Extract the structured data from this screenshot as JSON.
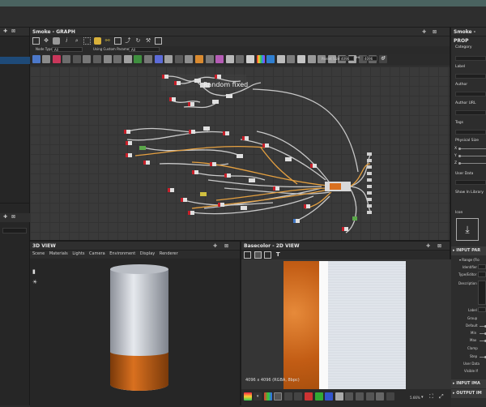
{
  "graph": {
    "title": "Smoke - GRAPH",
    "node_type_label": "Node Type",
    "node_type_value": "All",
    "custom_param_label": "Using Custom Parameter",
    "custom_param_value": "All",
    "parent_size_label": "Parent Size",
    "parent_size_w": "4096",
    "parent_size_h": "4096",
    "frame_text": "Random fixed"
  },
  "view3d": {
    "title": "3D VIEW",
    "menu": [
      "Scene",
      "Materials",
      "Lights",
      "Camera",
      "Environment",
      "Display",
      "Renderer"
    ]
  },
  "view2d": {
    "title": "Basecolor - 2D VIEW",
    "status": "4096 x 4096 (RGBA, 8bpc)",
    "zoom": "5.66%"
  },
  "properties": {
    "title": "Smoke - PROP",
    "fields": [
      "Category",
      "Label",
      "Author",
      "Author URL",
      "Tags"
    ],
    "physical_size_label": "Physical Size",
    "axes": [
      "X",
      "Y",
      "Z"
    ],
    "user_data_label": "User Data",
    "show_in_library_label": "Show In Library",
    "icon_label": "Icon",
    "input_params_header": "INPUT PAR",
    "range_label": "Range (Flo",
    "param_rows": [
      "Identifier",
      "Type/Editor",
      "Description"
    ],
    "lower_rows": [
      "Label",
      "Group",
      "Default",
      "Min",
      "Max",
      "Clamp",
      "Step",
      "User Data",
      "Visible If"
    ],
    "input_images_header": "INPUT IMA",
    "output_images_header": "OUTPUT IM"
  },
  "colors": {
    "accent_orange": "#d9701f",
    "node_red": "#c8202a",
    "wire_orange": "#e5a040",
    "graph_bg": "#3b3b3b",
    "topbar": "#4a6360"
  }
}
